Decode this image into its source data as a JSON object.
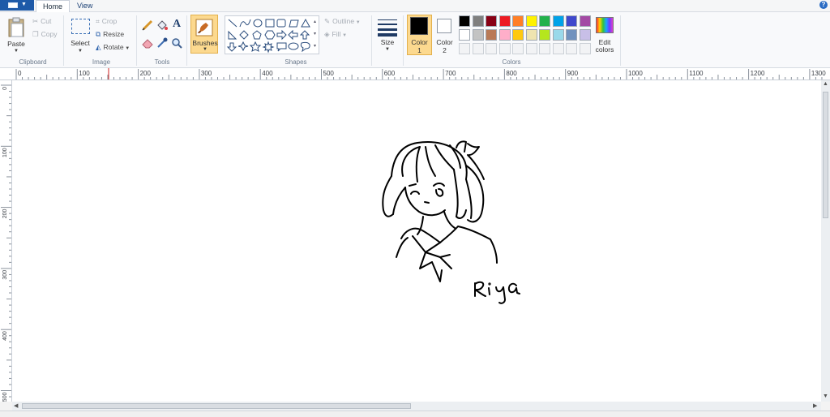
{
  "tabs": [
    {
      "label": "Home",
      "active": true
    },
    {
      "label": "View",
      "active": false
    }
  ],
  "clipboard": {
    "paste_label": "Paste",
    "cut_label": "Cut",
    "copy_label": "Copy",
    "group_label": "Clipboard"
  },
  "image": {
    "select_label": "Select",
    "crop_label": "Crop",
    "resize_label": "Resize",
    "rotate_label": "Rotate",
    "group_label": "Image"
  },
  "tools": {
    "group_label": "Tools",
    "items": [
      "pencil-icon",
      "fill-bucket-icon",
      "text-icon",
      "eraser-icon",
      "color-picker-icon",
      "magnifier-icon"
    ]
  },
  "brushes": {
    "label": "Brushes"
  },
  "shapes": {
    "group_label": "Shapes",
    "outline_label": "Outline",
    "fill_label": "Fill"
  },
  "size": {
    "label": "Size"
  },
  "colors": {
    "color1_label": "Color",
    "color1_num": "1",
    "color2_label": "Color",
    "color2_num": "2",
    "edit_label_1": "Edit",
    "edit_label_2": "colors",
    "group_label": "Colors",
    "color1_value": "#000000",
    "color2_value": "#ffffff",
    "palette_row1": [
      "#000000",
      "#7f7f7f",
      "#880015",
      "#ed1c24",
      "#ff7f27",
      "#fff200",
      "#22b14c",
      "#00a2e8",
      "#3f48cc",
      "#a349a4"
    ],
    "palette_row2": [
      "#ffffff",
      "#c3c3c3",
      "#b97a57",
      "#ffaec9",
      "#ffc90e",
      "#efe4b0",
      "#b5e61d",
      "#99d9ea",
      "#7092be",
      "#c8bfe7"
    ]
  },
  "ruler_top": [
    "0",
    "100",
    "200",
    "300",
    "400",
    "500",
    "600",
    "700",
    "800",
    "900",
    "1000",
    "1100",
    "1200",
    "1300"
  ],
  "ruler_left": [
    "0",
    "100",
    "200",
    "300",
    "400",
    "500"
  ],
  "canvas": {
    "signature_text": "Riya"
  }
}
